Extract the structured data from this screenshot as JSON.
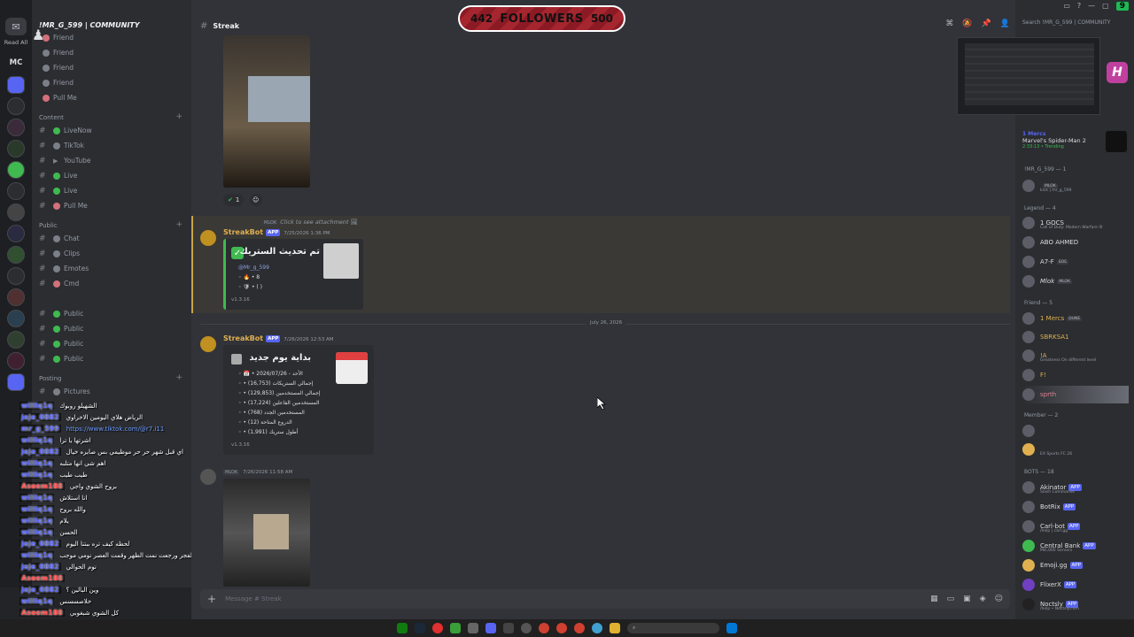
{
  "rail": {
    "read_all": "Read All",
    "mc": "MC"
  },
  "server": {
    "name": "!MR_G_599 | COMMUNITY"
  },
  "channels": {
    "top": [
      {
        "label": "Friend"
      },
      {
        "label": "Friend"
      },
      {
        "label": "Friend"
      },
      {
        "label": "Friend"
      },
      {
        "label": "Pull Me"
      }
    ],
    "content_cat": "Content",
    "content": [
      {
        "label": "LiveNow"
      },
      {
        "label": "TikTok"
      },
      {
        "label": "YouTube"
      },
      {
        "label": "Live"
      },
      {
        "label": "Live"
      },
      {
        "label": "Pull Me"
      }
    ],
    "public_cat": "Public",
    "public": [
      {
        "label": "Chat"
      },
      {
        "label": "Clips"
      },
      {
        "label": "Emotes"
      },
      {
        "label": "Cmd"
      },
      {
        "label": "Public"
      },
      {
        "label": "Public"
      },
      {
        "label": "Public"
      },
      {
        "label": "Public"
      }
    ],
    "posting_cat": "Posting",
    "posting": [
      {
        "label": "Pictures"
      }
    ]
  },
  "overlay_chat": [
    {
      "user": "williq1q",
      "msg": "الشهيلو روبوك",
      "red": false
    },
    {
      "user": "jeje_0882",
      "msg": "الرياض هلاي اليومين الاخراوي",
      "red": false
    },
    {
      "user": "mr_g_599",
      "msg": "https://www.tiktok.com/@r7.i11",
      "red": false,
      "link": true
    },
    {
      "user": "williq1q",
      "msg": "اشرتها يا ترا",
      "red": false
    },
    {
      "user": "jeje_0882",
      "msg": "اي قبل شهر حر حر موظيمي بس صايره خيال",
      "red": false
    },
    {
      "user": "williq1q",
      "msg": "اهم شي انها متلبه",
      "red": false
    },
    {
      "user": "williq1q",
      "msg": "طيب طيب",
      "red": false
    },
    {
      "user": "Aseem188",
      "msg": "بروح الشوي واجي",
      "red": true
    },
    {
      "user": "williq1q",
      "msg": "انا استلاش",
      "red": false
    },
    {
      "user": "williq1q",
      "msg": "والله بروح",
      "red": false
    },
    {
      "user": "williq1q",
      "msg": "يلام",
      "red": false
    },
    {
      "user": "williq1q",
      "msg": "الحسن",
      "red": false
    },
    {
      "user": "jeje_0882",
      "msg": "لحظه كيف تره ببتنا اليوم",
      "red": false
    },
    {
      "user": "williq1q",
      "msg": "الله الفجر ورجعت نمت الظهر وقمت العصر نومي موجب",
      "red": false
    },
    {
      "user": "jeje_0882",
      "msg": "نوم الحوالي",
      "red": false
    },
    {
      "user": "Aseem188",
      "msg": "",
      "red": true
    },
    {
      "user": "jeje_0882",
      "msg": "وين البالين ؟",
      "red": false
    },
    {
      "user": "williq1q",
      "msg": "خلاصسسس",
      "red": false
    },
    {
      "user": "Aseem188",
      "msg": "كل الشوي شبغوبي",
      "red": true
    }
  ],
  "channel_header": {
    "name": "Streak"
  },
  "followers": {
    "current": "442",
    "label": "FOLLOWERS",
    "goal": "500"
  },
  "messages": {
    "reaction_count": "1",
    "reply": {
      "tag": "MLOK",
      "text": "Click to see attachment"
    },
    "m1": {
      "author": "StreakBot",
      "badge": "APP",
      "time": "7/25/2026 1:36 PM",
      "title": "تم تحديث الستريك",
      "mention": "@Mr_g_599",
      "line1": "8",
      "line2": "(   )",
      "footer": "v1.3.16"
    },
    "date_divider": "July 26, 2026",
    "m2": {
      "author": "StreakBot",
      "badge": "APP",
      "time": "7/26/2026 12:53 AM",
      "title": "بداية يوم جديد",
      "date": "2026/07/26 - الأحد",
      "stats": [
        {
          "value": "(16,753)",
          "label": "إجمالي الستريكات"
        },
        {
          "value": "(129,853)",
          "label": "إجمالي المستخدمين"
        },
        {
          "value": "(17,224)",
          "label": "المستخدمين الفاعلين"
        },
        {
          "value": "(768)",
          "label": "المستخدمين الجدد"
        },
        {
          "value": "(12)",
          "label": "الدروع المتاحة"
        },
        {
          "value": "(1,991)",
          "label": "أطول ستريك"
        }
      ],
      "footer": "v1.3.16"
    },
    "m3": {
      "tag": "MLOK",
      "time": "7/26/2026 11:58 AM"
    },
    "composer_placeholder": "Message # Streak"
  },
  "members": {
    "search_placeholder": "Search !MR_G_599 | COMMUNITY",
    "activity": {
      "title": "1 Mercs",
      "game": "Marvel's Spider-Man 2",
      "time": "2:33:13",
      "trending": "Trending"
    },
    "owner_section": "!MR_G_599 — 1",
    "owner": {
      "tag": "MLOK",
      "sub": "kick | mr_g_599"
    },
    "legend_section": "Legend — 4",
    "legend": [
      {
        "name": "1 GOCS",
        "sub": "Call of Duty: Modern Warfare III"
      },
      {
        "name": "ABO AHMED",
        "sub": ""
      },
      {
        "name": "A7-F",
        "tag": "SOE",
        "sub": ""
      },
      {
        "name": "Mlok",
        "tag": "MLOK",
        "sub": ""
      }
    ],
    "friend_section": "Friend — 5",
    "friends": [
      {
        "name": "1 Mercs",
        "tag": "DUNE",
        "sub": ""
      },
      {
        "name": "SBRKSA1",
        "sub": ""
      },
      {
        "name": "!A",
        "sub": "Greatness On different level"
      },
      {
        "name": "F!",
        "sub": ""
      },
      {
        "name": "sprth",
        "sub": ""
      }
    ],
    "member_section": "Member — 2",
    "member_list": [
      {
        "name": "",
        "sub": ""
      },
      {
        "name": "",
        "sub": "EA Sports FC 26"
      }
    ],
    "bots_section": "BOTS — 18",
    "bots": [
      {
        "name": "Akinator",
        "badge": "APP",
        "sub": "Slash Commands"
      },
      {
        "name": "BotRix",
        "badge": "APP",
        "sub": ""
      },
      {
        "name": "Carl-bot",
        "badge": "APP",
        "sub": "/help | carl.gg"
      },
      {
        "name": "Central Bank",
        "badge": "APP",
        "sub": "Mill,000 Servers"
      },
      {
        "name": "Emoji.gg",
        "badge": "APP",
        "sub": ""
      },
      {
        "name": "FlixerX",
        "badge": "APP",
        "sub": ""
      },
      {
        "name": "Noctsly",
        "badge": "APP",
        "sub": "/help • Noctsly.com"
      }
    ]
  },
  "system": {
    "battery": "9"
  },
  "colors": {
    "accent": "#5865f2",
    "streak_green": "#3fb950",
    "highlight": "#c9a64a"
  }
}
